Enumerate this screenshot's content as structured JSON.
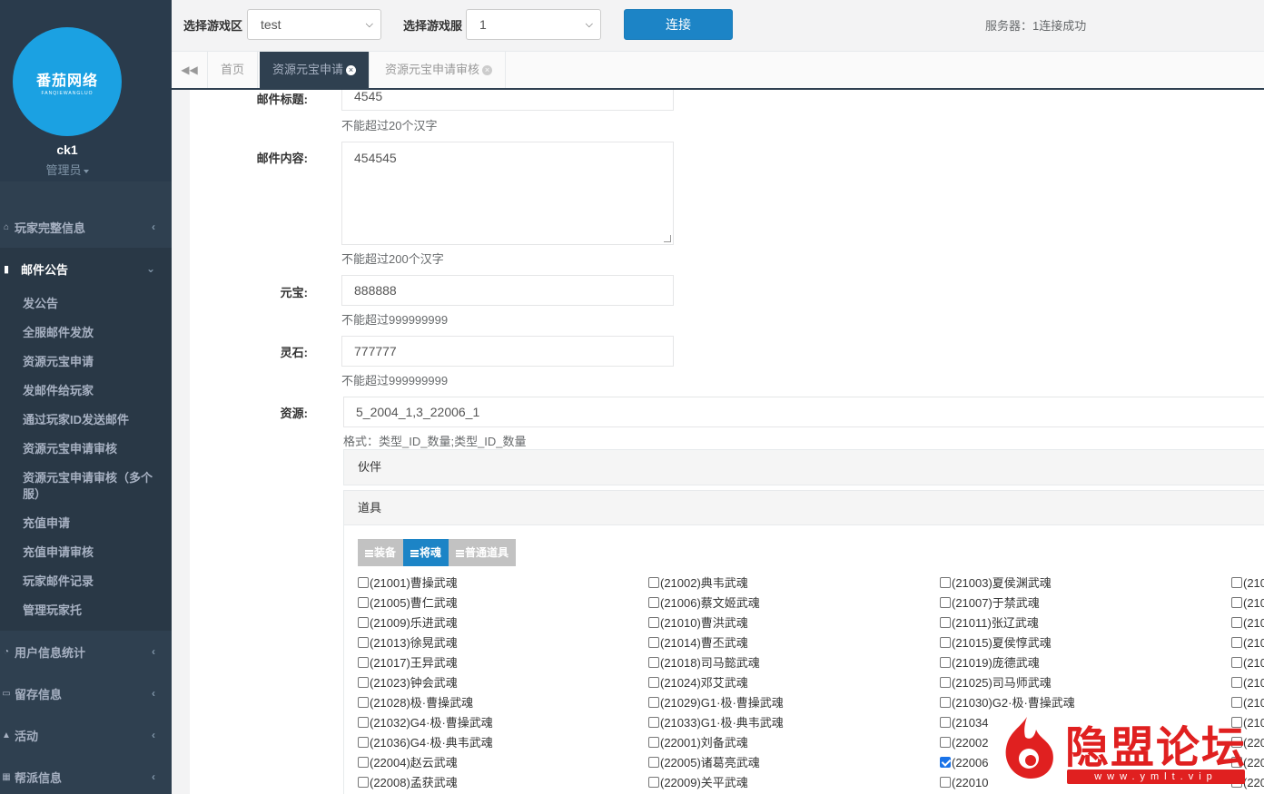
{
  "sidebar": {
    "logo": {
      "main": "番茄网络",
      "sub": "FANQIEWANGLUO"
    },
    "username": "ck1",
    "role": "管理员",
    "menu": [
      {
        "label": "玩家完整信息",
        "icon": "home-icon"
      },
      {
        "label": "邮件公告",
        "icon": "bar-chart-icon",
        "expanded": true
      },
      {
        "label": "用户信息统计",
        "icon": "pie-chart-icon"
      },
      {
        "label": "留存信息",
        "icon": "desktop-icon"
      },
      {
        "label": "活动",
        "icon": "flask-icon"
      },
      {
        "label": "帮派信息",
        "icon": "table-icon"
      }
    ],
    "submenu": [
      "发公告",
      "全服邮件发放",
      "资源元宝申请",
      "发邮件给玩家",
      "通过玩家ID发送邮件",
      "资源元宝申请审核",
      "资源元宝申请审核（多个服）",
      "充值申请",
      "充值申请审核",
      "玩家邮件记录",
      "管理玩家托"
    ]
  },
  "topbar": {
    "zone_label": "选择游戏区",
    "zone_value": "test",
    "server_label": "选择游戏服",
    "server_value": "1",
    "connect_label": "连接",
    "status": "服务器：1连接成功"
  },
  "tabs": [
    {
      "label": "首页",
      "active": false,
      "closable": false
    },
    {
      "label": "资源元宝申请",
      "active": true,
      "closable": true
    },
    {
      "label": "资源元宝申请审核",
      "active": false,
      "closable": true
    }
  ],
  "form": {
    "mail_title": {
      "label": "邮件标题:",
      "value": "4545",
      "help": "不能超过20个汉字"
    },
    "mail_content": {
      "label": "邮件内容:",
      "value": "454545",
      "help": "不能超过200个汉字"
    },
    "yuanbao": {
      "label": "元宝:",
      "value": "888888",
      "help": "不能超过999999999"
    },
    "lingshi": {
      "label": "灵石:",
      "value": "777777",
      "help": "不能超过999999999"
    },
    "resource": {
      "label": "资源:",
      "value": "5_2004_1,3_22006_1",
      "help": "格式：类型_ID_数量;类型_ID_数量"
    }
  },
  "panels": {
    "partner": "伙伴",
    "items": "道具"
  },
  "item_buttons": [
    {
      "label": "装备",
      "active": false
    },
    {
      "label": "将魂",
      "active": true
    },
    {
      "label": "普通道具",
      "active": false
    }
  ],
  "items": [
    [
      "(21001)曹操武魂",
      "(21002)典韦武魂",
      "(21003)夏侯渊武魂",
      "(210"
    ],
    [
      "(21005)曹仁武魂",
      "(21006)蔡文姬武魂",
      "(21007)于禁武魂",
      "(210"
    ],
    [
      "(21009)乐进武魂",
      "(21010)曹洪武魂",
      "(21011)张辽武魂",
      "(210"
    ],
    [
      "(21013)徐晃武魂",
      "(21014)曹丕武魂",
      "(21015)夏侯惇武魂",
      "(210"
    ],
    [
      "(21017)王异武魂",
      "(21018)司马懿武魂",
      "(21019)庞德武魂",
      "(210"
    ],
    [
      "(21023)钟会武魂",
      "(21024)邓艾武魂",
      "(21025)司马师武魂",
      "(210"
    ],
    [
      "(21028)极·曹操武魂",
      "(21029)G1·极·曹操武魂",
      "(21030)G2·极·曹操武魂",
      "(210"
    ],
    [
      "(21032)G4·极·曹操武魂",
      "(21033)G1·极·典韦武魂",
      "(21034",
      "(210"
    ],
    [
      "(21036)G4·极·典韦武魂",
      "(22001)刘备武魂",
      "(22002",
      "(220"
    ],
    [
      "(22004)赵云武魂",
      "(22005)诸葛亮武魂",
      "(22006",
      "(220"
    ],
    [
      "(22008)孟获武魂",
      "(22009)关平武魂",
      "(22010",
      "(220"
    ]
  ],
  "checked_item": "(22006",
  "watermark": {
    "text": "隐盟论坛",
    "url": "www.ymlt.vip"
  },
  "colors": {
    "sidebar": "#2f4050",
    "accent": "#1c84c6",
    "watermark": "#e02020"
  }
}
